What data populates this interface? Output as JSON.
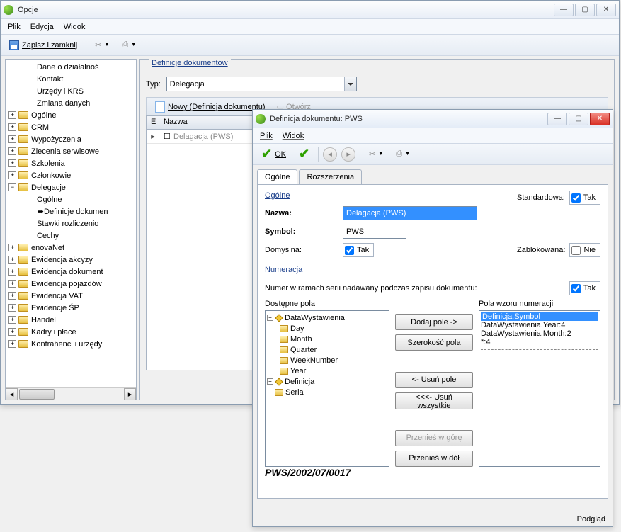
{
  "mainWindow": {
    "title": "Opcje",
    "menu": {
      "file": "Plik",
      "edit": "Edycja",
      "view": "Widok"
    },
    "toolbar": {
      "saveClose": "Zapisz i zamknij"
    }
  },
  "tree": {
    "topItems": [
      "Dane o działalnoś",
      "Kontakt",
      "Urzędy i KRS",
      "Zmiana danych"
    ],
    "folders1": [
      "Ogólne",
      "CRM",
      "Wypożyczenia",
      "Zlecenia serwisowe",
      "Szkolenia",
      "Członkowie"
    ],
    "delegacje": {
      "label": "Delegacje",
      "children": [
        "Ogólne",
        "Definicje dokumen",
        "Stawki rozliczenio",
        "Cechy"
      ]
    },
    "folders2": [
      "enovaNet",
      "Ewidencja akcyzy",
      "Ewidencja dokument",
      "Ewidencja pojazdów",
      "Ewidencja VAT",
      "Ewidencje ŚP",
      "Handel",
      "Kadry i płace",
      "Kontrahenci i urzędy"
    ]
  },
  "rightPanel": {
    "legend": "Definicje dokumentów",
    "typLabel": "Typ:",
    "typValue": "Delegacja",
    "newBtn": "Nowy (Definicja dokumentu)",
    "openBtn": "Otwórz",
    "colE": "E",
    "colName": "Nazwa",
    "row1": "Delagacja (PWS)"
  },
  "dialog": {
    "title": "Definicja dokumentu: PWS",
    "menu": {
      "file": "Plik",
      "view": "Widok"
    },
    "okBtn": "OK",
    "tabs": {
      "general": "Ogólne",
      "ext": "Rozszerzenia"
    },
    "sectionGeneral": "Ogólne",
    "standardLabel": "Standardowa:",
    "takLabel": "Tak",
    "nieLabel": "Nie",
    "nazwaLabel": "Nazwa:",
    "nazwaValue": "Delagacja (PWS)",
    "symbolLabel": "Symbol:",
    "symbolValue": "PWS",
    "defaultLabel": "Domyślna:",
    "lockedLabel": "Zablokowana:",
    "sectionNum": "Numeracja",
    "numDesc": "Numer w ramach serii nadawany podczas zapisu dokumentu:",
    "availLabel": "Dostępne pola",
    "patternLabel": "Pola wzoru numeracji",
    "availTree": {
      "root": "DataWystawienia",
      "children": [
        "Day",
        "Month",
        "Quarter",
        "WeekNumber",
        "Year"
      ],
      "siblings": [
        "Definicja",
        "Seria"
      ]
    },
    "patternItems": [
      "Definicja.Symbol",
      "DataWystawienia.Year:4",
      "DataWystawienia.Month:2",
      "*:4"
    ],
    "btns": {
      "add": "Dodaj pole ->",
      "width": "Szerokość pola",
      "remove": "<- Usuń pole",
      "removeAll": "<<<- Usuń wszystkie",
      "moveUp": "Przenieś w górę",
      "moveDown": "Przenieś w dół"
    },
    "preview": "PWS/2002/07/0017",
    "footer": "Podgląd"
  }
}
